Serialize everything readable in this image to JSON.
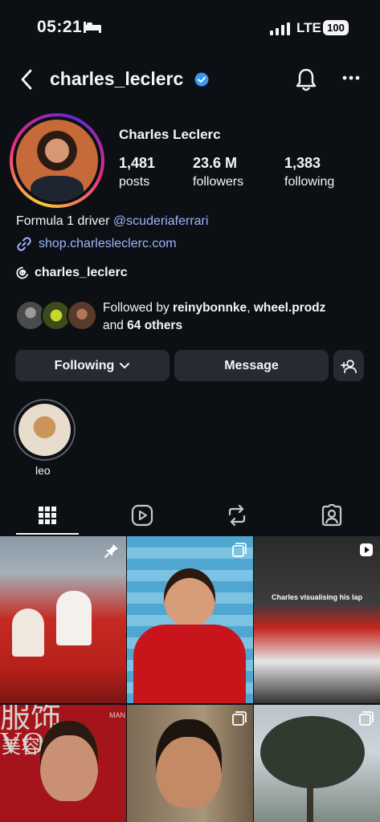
{
  "status_bar": {
    "time": "05:21",
    "network": "LTE",
    "battery": "100"
  },
  "header": {
    "username": "charles_leclerc"
  },
  "profile": {
    "name": "Charles Leclerc",
    "stats": [
      {
        "value": "1,481",
        "label": "posts"
      },
      {
        "value": "23.6 M",
        "label": "followers"
      },
      {
        "value": "1,383",
        "label": "following"
      }
    ],
    "bio_text": "Formula 1 driver ",
    "bio_mention": "@scuderiaferrari",
    "link": "shop.charlesleclerc.com",
    "threads_handle": "charles_leclerc"
  },
  "followed_by": {
    "prefix": "Followed by ",
    "user1": "reinybonnke",
    "sep": ", ",
    "user2": "wheel.prodz",
    "and": "and ",
    "others": "64 others"
  },
  "buttons": {
    "following": "Following",
    "message": "Message"
  },
  "highlights": [
    {
      "label": "leo"
    }
  ],
  "tabs": [
    "grid-icon",
    "reels-icon",
    "reposts-icon",
    "tagged-icon"
  ],
  "grid": {
    "post3_caption": "Charles visualising his lap",
    "vogue_title": "服饰VOGU",
    "vogue_sub": "美容",
    "vogue_corner": "MAN"
  }
}
